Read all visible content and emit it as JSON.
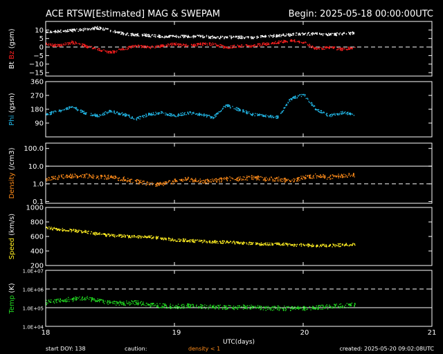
{
  "header": {
    "title": "ACE RTSW[Estimated] MAG & SWEPAM",
    "begin": "Begin: 2025-05-18 00:00:00UTC"
  },
  "footer": {
    "start_doy": "start DOY: 138",
    "caution": "caution:",
    "density_note": "density < 1",
    "created": "created: 2025-05-20 09:02:08UTC",
    "xlabel": "UTC(days)"
  },
  "colors": {
    "background": "#000000",
    "axes": "#ffffff",
    "bt": "#ffffff",
    "bz": "#ff2020",
    "phi": "#22b8e8",
    "density": "#ff8c1a",
    "speed": "#ffee22",
    "temp": "#22dd22"
  },
  "chart_data": [
    {
      "type": "scatter",
      "ylabel": "Bt  Bz  (gsm)",
      "ylim": [
        -17,
        15
      ],
      "yticks": [
        -15,
        -10,
        -5,
        0,
        5,
        10
      ],
      "ticklabels": [
        "−15",
        "−10",
        "−5",
        "0",
        "5",
        "10"
      ],
      "ref_lines": [
        {
          "y": 0,
          "style": "dashed"
        }
      ],
      "x": [
        18.0,
        18.1,
        18.2,
        18.3,
        18.4,
        18.5,
        18.6,
        18.7,
        18.8,
        18.9,
        19.0,
        19.1,
        19.2,
        19.3,
        19.4,
        19.5,
        19.6,
        19.7,
        19.8,
        19.9,
        20.0,
        20.1,
        20.2,
        20.3,
        20.4
      ],
      "series": [
        {
          "name": "Bt",
          "values": [
            9,
            9.5,
            10,
            10.5,
            11.5,
            10,
            8,
            7.5,
            7,
            6.5,
            6.5,
            6.5,
            6.5,
            6,
            6,
            6,
            6,
            6.5,
            7,
            7.5,
            8,
            8,
            7.5,
            8,
            8.5
          ]
        },
        {
          "name": "Bz",
          "values": [
            2,
            1,
            3,
            1,
            -1,
            -3,
            -1,
            1,
            0,
            1,
            2,
            1,
            2,
            2,
            0,
            1,
            1,
            2,
            3,
            4,
            3,
            -1,
            0,
            -1,
            0
          ]
        }
      ]
    },
    {
      "type": "scatter",
      "ylabel": "Phi (gsm)",
      "ylim": [
        0,
        360
      ],
      "yticks": [
        90,
        180,
        270,
        360
      ],
      "ticklabels": [
        "90",
        "180",
        "270",
        "360"
      ],
      "x": [
        18.0,
        18.1,
        18.2,
        18.3,
        18.4,
        18.5,
        18.6,
        18.7,
        18.8,
        18.9,
        19.0,
        19.1,
        19.2,
        19.3,
        19.4,
        19.5,
        19.6,
        19.7,
        19.8,
        19.9,
        20.0,
        20.1,
        20.2,
        20.3,
        20.4
      ],
      "series": [
        {
          "name": "Phi",
          "values": [
            150,
            170,
            200,
            160,
            140,
            170,
            150,
            120,
            150,
            160,
            140,
            160,
            150,
            130,
            210,
            180,
            150,
            140,
            130,
            250,
            280,
            180,
            140,
            160,
            150
          ]
        }
      ]
    },
    {
      "type": "scatter",
      "ylabel": "Density (/cm3)",
      "scale": "log",
      "ylim": [
        0.08,
        200
      ],
      "yticks": [
        0.1,
        1.0,
        10.0,
        100.0
      ],
      "ticklabels": [
        "0.1",
        "1.0",
        "10.0",
        "100.0"
      ],
      "ref_lines": [
        {
          "y": 1,
          "style": "dashed"
        },
        {
          "y": 10,
          "style": "solid"
        }
      ],
      "x": [
        18.0,
        18.1,
        18.2,
        18.3,
        18.4,
        18.5,
        18.6,
        18.7,
        18.8,
        18.9,
        19.0,
        19.1,
        19.2,
        19.3,
        19.4,
        19.5,
        19.6,
        19.7,
        19.8,
        19.9,
        20.0,
        20.1,
        20.2,
        20.3,
        20.4
      ],
      "series": [
        {
          "name": "Density",
          "values": [
            2.0,
            2.5,
            3.0,
            3.0,
            2.5,
            2.5,
            2.0,
            1.5,
            1.0,
            1.0,
            1.5,
            2.0,
            1.5,
            1.5,
            2.0,
            2.0,
            2.5,
            2.0,
            2.0,
            1.5,
            2.5,
            3.0,
            2.5,
            3.0,
            3.5
          ]
        }
      ]
    },
    {
      "type": "scatter",
      "ylabel": "Speed (km/s)",
      "ylim": [
        200,
        1000
      ],
      "yticks": [
        200,
        400,
        600,
        800,
        1000
      ],
      "ticklabels": [
        "200",
        "400",
        "600",
        "800",
        "1000"
      ],
      "x": [
        18.0,
        18.1,
        18.2,
        18.3,
        18.4,
        18.5,
        18.6,
        18.7,
        18.8,
        18.9,
        19.0,
        19.1,
        19.2,
        19.3,
        19.4,
        19.5,
        19.6,
        19.7,
        19.8,
        19.9,
        20.0,
        20.1,
        20.2,
        20.3,
        20.4
      ],
      "series": [
        {
          "name": "Speed",
          "values": [
            730,
            700,
            690,
            670,
            640,
            620,
            610,
            600,
            600,
            580,
            560,
            550,
            540,
            530,
            530,
            520,
            510,
            500,
            500,
            490,
            490,
            480,
            480,
            490,
            500
          ]
        }
      ]
    },
    {
      "type": "scatter",
      "ylabel": "Temp (K)",
      "scale": "log",
      "ylim": [
        10000,
        10000000
      ],
      "yticks": [
        10000,
        100000,
        1000000,
        10000000
      ],
      "ticklabels": [
        "1.0E+04",
        "1.0E+05",
        "1.0E+06",
        "1.0E+07"
      ],
      "ref_lines": [
        {
          "y": 100000,
          "style": "solid"
        },
        {
          "y": 1000000,
          "style": "dashed"
        }
      ],
      "x": [
        18.0,
        18.1,
        18.2,
        18.3,
        18.4,
        18.5,
        18.6,
        18.7,
        18.8,
        18.9,
        19.0,
        19.1,
        19.2,
        19.3,
        19.4,
        19.5,
        19.6,
        19.7,
        19.8,
        19.9,
        20.0,
        20.1,
        20.2,
        20.3,
        20.4
      ],
      "series": [
        {
          "name": "Temp",
          "values": [
            200000,
            250000,
            300000,
            350000,
            250000,
            200000,
            180000,
            200000,
            150000,
            130000,
            120000,
            130000,
            120000,
            120000,
            110000,
            110000,
            120000,
            100000,
            100000,
            95000,
            95000,
            110000,
            120000,
            130000,
            150000
          ]
        }
      ]
    }
  ],
  "x_axis": {
    "xlim": [
      18,
      21
    ],
    "ticks": [
      18,
      19,
      20,
      21
    ],
    "ticklabels": [
      "18",
      "19",
      "20",
      "21"
    ]
  }
}
